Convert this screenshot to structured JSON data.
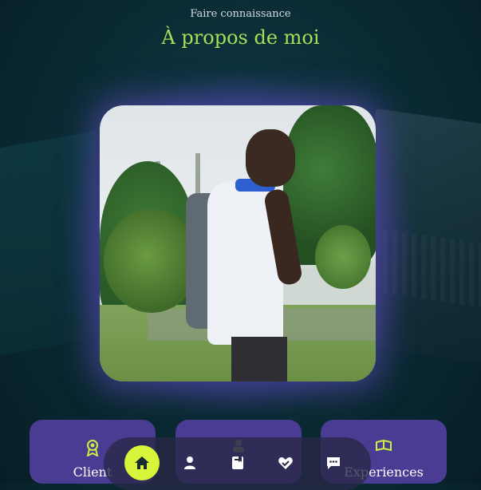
{
  "header": {
    "subtitle": "Faire connaissance",
    "title": "À propos de moi"
  },
  "photo": {
    "alt": "Photo de profil"
  },
  "cards": [
    {
      "label": "Client",
      "icon": "award-icon"
    },
    {
      "label": "",
      "icon": "users-icon"
    },
    {
      "label": "Experiences",
      "icon": "briefcase-icon"
    }
  ],
  "nav": {
    "items": [
      {
        "name": "home",
        "icon": "home-icon",
        "active": true
      },
      {
        "name": "about",
        "icon": "user-icon",
        "active": false
      },
      {
        "name": "resume",
        "icon": "book-icon",
        "active": false
      },
      {
        "name": "services",
        "icon": "handshake-icon",
        "active": false
      },
      {
        "name": "contact",
        "icon": "chat-icon",
        "active": false
      }
    ]
  },
  "colors": {
    "accent": "#a3e05a",
    "nav_active": "#d8f53b",
    "card_bg": "#4b3c93",
    "glow": "#6e50d2"
  }
}
